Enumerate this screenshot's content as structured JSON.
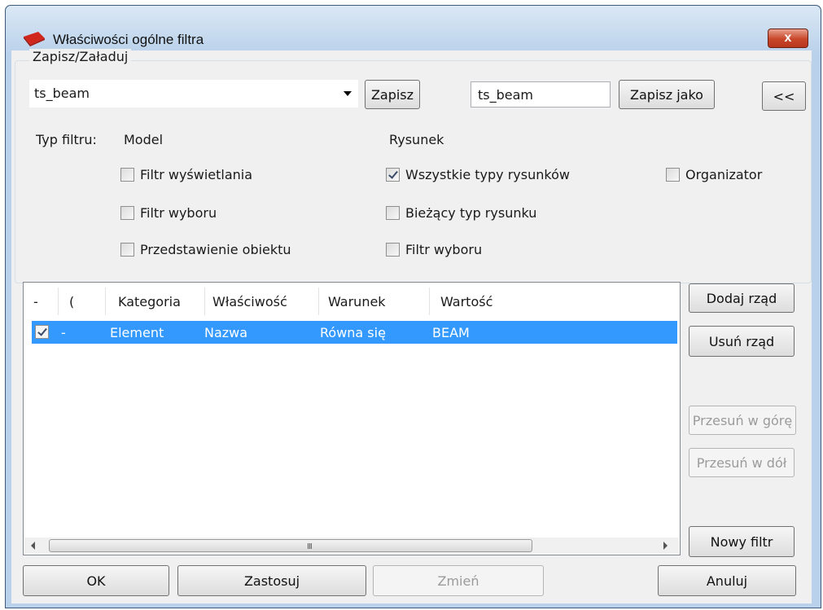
{
  "window": {
    "title": "Właściwości ogólne filtra",
    "close_label": "x"
  },
  "save_load": {
    "legend": "Zapisz/Załaduj",
    "combo_value": "ts_beam",
    "save_label": "Zapisz",
    "name_field_value": "ts_beam",
    "save_as_label": "Zapisz jako",
    "collapse_label": "<<"
  },
  "filter_type": {
    "label": "Typ filtru:",
    "model_header": "Model",
    "drawing_header": "Rysunek",
    "model_options": [
      {
        "label": "Filtr wyświetlania",
        "checked": false
      },
      {
        "label": "Filtr wyboru",
        "checked": false
      },
      {
        "label": "Przedstawienie obiektu",
        "checked": false
      }
    ],
    "drawing_options": [
      {
        "label": "Wszystkie typy rysunków",
        "checked": true
      },
      {
        "label": "Bieżący typ rysunku",
        "checked": false
      },
      {
        "label": "Filtr wyboru",
        "checked": false
      }
    ],
    "organizer": {
      "label": "Organizator",
      "checked": false
    }
  },
  "grid": {
    "columns": [
      "-",
      "(",
      "Kategoria",
      "Właściwość",
      "Warunek",
      "Wartość"
    ],
    "rows": [
      {
        "checked": true,
        "paren": "-",
        "category": "Element",
        "property": "Nazwa",
        "condition": "Równa się",
        "value": "BEAM"
      }
    ],
    "scroll_grip": "III"
  },
  "side_buttons": {
    "add_row": "Dodaj rząd",
    "remove_row": "Usuń rząd",
    "move_up": "Przesuń w górę",
    "move_down": "Przesuń w dół",
    "new_filter": "Nowy filtr"
  },
  "bottom_buttons": {
    "ok": "OK",
    "apply": "Zastosuj",
    "modify": "Zmień",
    "cancel": "Anuluj"
  },
  "colors": {
    "selection": "#3399ff",
    "close_button": "#c8462a"
  }
}
